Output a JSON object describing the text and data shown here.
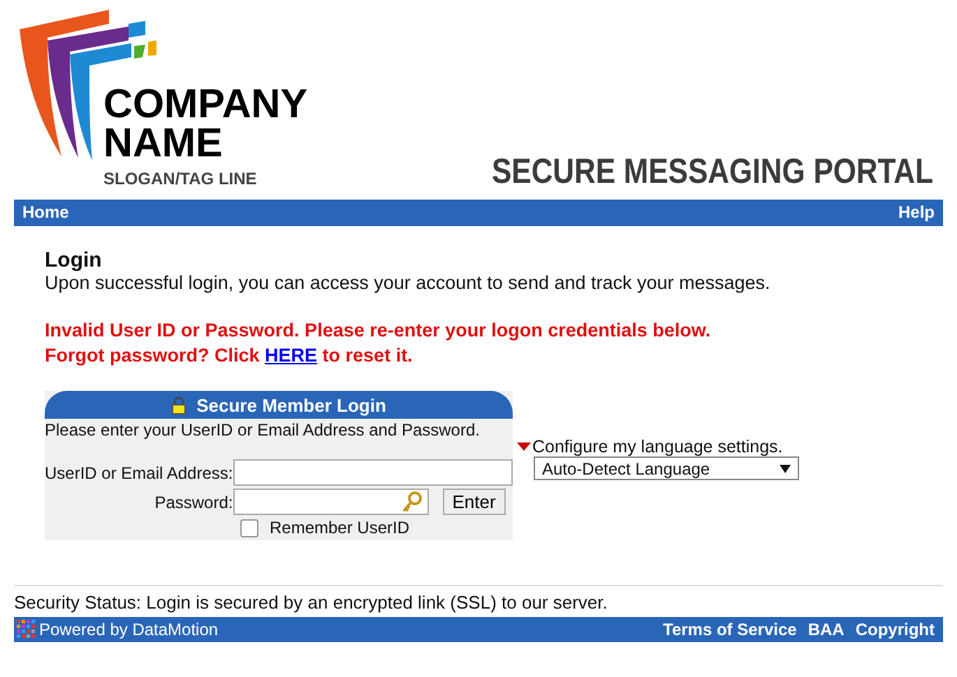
{
  "logo": {
    "name_lines": [
      "COMPANY",
      "NAME"
    ],
    "slogan": "SLOGAN/TAG LINE"
  },
  "portal_title": "SECURE MESSAGING PORTAL",
  "nav": {
    "left": "Home",
    "right": "Help"
  },
  "login": {
    "heading": "Login",
    "intro": "Upon successful login, you can access your account to send and track your messages.",
    "error_line": "Invalid User ID or Password. Please re-enter your logon credentials below.",
    "forgot_before": "Forgot password? Click",
    "forgot_link": "HERE",
    "forgot_after": "to reset it."
  },
  "panel": {
    "title": "Secure Member Login",
    "instructions": "Please enter your UserID or Email Address and Password.",
    "user_label": "UserID or Email Address:",
    "password_label": "Password:",
    "enter_button": "Enter",
    "remember": {
      "label": "Remember UserID",
      "checked": false
    }
  },
  "language": {
    "label": "Configure my language settings.",
    "value": "Auto-Detect Language"
  },
  "security_status": "Security Status: Login is secured by an encrypted link (SSL) to our server.",
  "footer": {
    "powered": "Powered by DataMotion",
    "links": [
      "Terms of Service",
      "BAA",
      "Copyright"
    ]
  }
}
